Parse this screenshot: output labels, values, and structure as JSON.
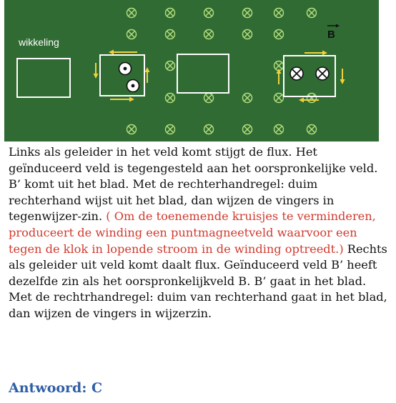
{
  "figure": {
    "label_coil": "wikkeling",
    "label_field": "B",
    "colors": {
      "background": "#2f6b33",
      "symbol": "#b7e07f",
      "outline": "#ffffff",
      "arrow": "#f2d23a"
    }
  },
  "text": {
    "part1": "Links als geleider in het veld komt stijgt de flux. Het geïnduceerd veld is tegengesteld aan het oorspronkelijke veld. B’ komt uit het blad. Met de rechterhandregel: duim rechterhand wijst uit het blad, dan wijzen de vingers in tegenwijzer-zin. ",
    "red": "( Om de toenemende kruisjes te verminderen, produceert de winding een puntmagneetveld waarvoor een tegen de klok in lopende stroom in de winding optreedt.)",
    "part2": "  Rechts als geleider uit veld komt daalt flux. Geïnduceerd veld B’ heeft dezelfde zin als het oorspronkelijkveld B. B’ gaat in het blad. Met de rechtrhandregel: duim van rechterhand gaat in het blad, dan wijzen de vingers in wijzerzin."
  },
  "answer": "Antwoord: C"
}
